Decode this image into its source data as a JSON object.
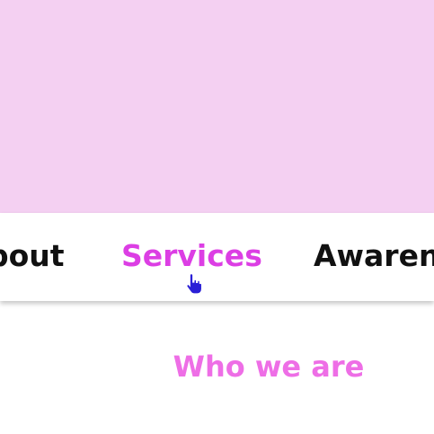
{
  "nav": {
    "items": [
      {
        "label": "bout",
        "active": false
      },
      {
        "label": "Services",
        "active": true
      },
      {
        "label": "Awaren",
        "active": false
      }
    ]
  },
  "section": {
    "title": "Who we are"
  },
  "colors": {
    "hero_background": "#f4d0f2",
    "nav_active": "#dc3ee4",
    "nav_default": "#111111",
    "section_title": "#ee6ee6",
    "cursor": "#2a1fd6"
  },
  "cursor": {
    "icon": "hand-pointer-icon"
  }
}
